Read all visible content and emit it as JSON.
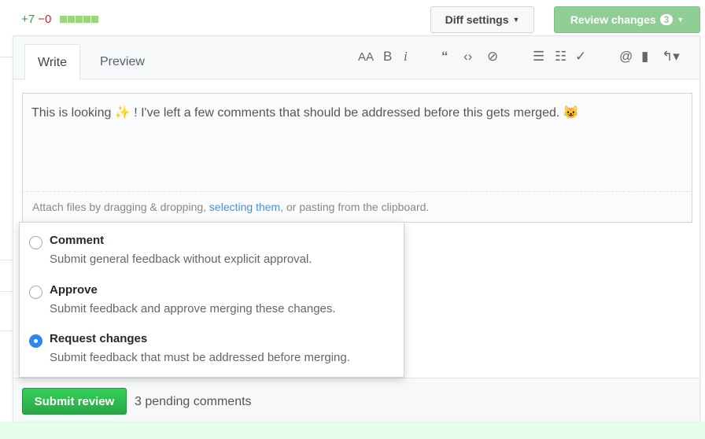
{
  "header": {
    "additions": "+7",
    "deletions": "−0",
    "diff_settings": "Diff settings",
    "review_changes": "Review changes",
    "review_count": "3"
  },
  "editor": {
    "tabs": [
      {
        "label": "Write",
        "active": true
      },
      {
        "label": "Preview",
        "active": false
      }
    ],
    "toolbar": [
      "text-size-icon",
      "bold-icon",
      "italic-icon",
      "quote-icon",
      "code-icon",
      "link-icon",
      "bulleted-list-icon",
      "numbered-list-icon",
      "task-list-icon",
      "mention-icon",
      "saved-reply-icon",
      "reply-icon"
    ],
    "text": "This is looking ✨ ! I've left a few comments that should be addressed before this gets merged. 😺",
    "attach_prefix": "Attach files by dragging & dropping, ",
    "attach_link": "selecting them",
    "attach_suffix": ", or pasting from the clipboard."
  },
  "review_options": [
    {
      "title": "Comment",
      "desc": "Submit general feedback without explicit approval.",
      "selected": false
    },
    {
      "title": "Approve",
      "desc": "Submit feedback and approve merging these changes.",
      "selected": false
    },
    {
      "title": "Request changes",
      "desc": "Submit feedback that must be addressed before merging.",
      "selected": true
    }
  ],
  "footer": {
    "submit": "Submit review",
    "pending": "3 pending comments"
  },
  "colors": {
    "accent": "#2f86ec",
    "submit": "#2cbe4e",
    "review_button": "#8fce95"
  }
}
